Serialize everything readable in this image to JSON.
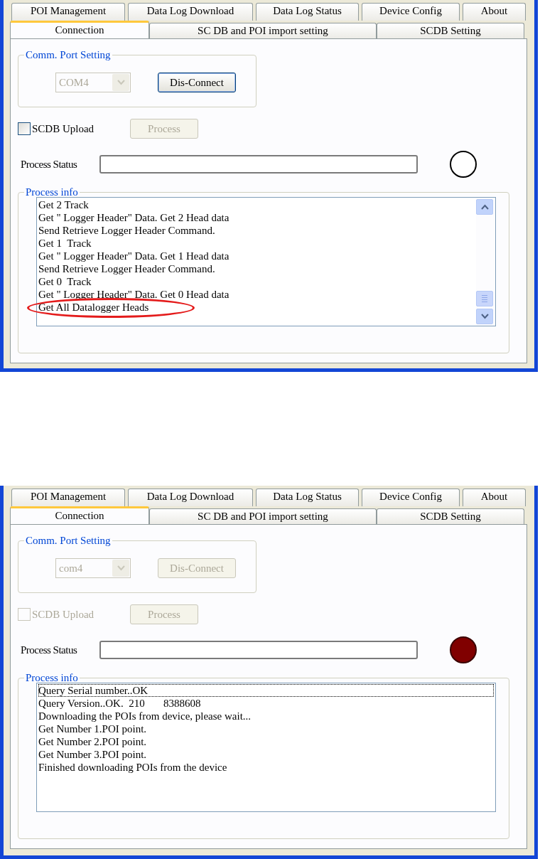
{
  "panels": [
    {
      "tab_rows": [
        [
          {
            "label": "POI Management",
            "selected": false
          },
          {
            "label": "Data Log Download",
            "selected": false
          },
          {
            "label": "Data Log Status",
            "selected": false
          },
          {
            "label": "Device Config",
            "selected": false
          },
          {
            "label": "About",
            "selected": false
          }
        ],
        [
          {
            "label": "Connection",
            "selected": true
          },
          {
            "label": "SC DB and POI import setting",
            "selected": false
          },
          {
            "label": "SCDB  Setting",
            "selected": false
          }
        ]
      ],
      "port_group": {
        "title": "Comm. Port Setting",
        "port": {
          "value": "COM4",
          "disabled": true
        },
        "connect_button": {
          "label": "Dis-Connect",
          "disabled": false
        }
      },
      "upload": {
        "label": "SCDB Upload",
        "checked": false,
        "disabled": false
      },
      "process_button": {
        "label": "Process",
        "disabled": true
      },
      "status": {
        "label": "Process Status",
        "indicator_on": false
      },
      "info_group": {
        "title": "Process info",
        "has_scrollbar": true,
        "lines": [
          {
            "text": "Get 2 Track",
            "selected": false,
            "circled": false
          },
          {
            "text": "Get \" Logger Header\" Data. Get 2 Head data",
            "selected": false,
            "circled": false
          },
          {
            "text": "Send Retrieve Logger Header Command.",
            "selected": false,
            "circled": false
          },
          {
            "text": "Get 1  Track",
            "selected": false,
            "circled": false
          },
          {
            "text": "Get \" Logger Header\" Data. Get 1 Head data",
            "selected": false,
            "circled": false
          },
          {
            "text": "Send Retrieve Logger Header Command.",
            "selected": false,
            "circled": false
          },
          {
            "text": "Get 0  Track",
            "selected": false,
            "circled": false
          },
          {
            "text": "Get \" Logger Header\" Data. Get 0 Head data",
            "selected": false,
            "circled": false
          },
          {
            "text": "Get All Datalogger Heads",
            "selected": false,
            "circled": true
          }
        ]
      }
    },
    {
      "tab_rows": [
        [
          {
            "label": "POI Management",
            "selected": false
          },
          {
            "label": "Data Log Download",
            "selected": false
          },
          {
            "label": "Data Log Status",
            "selected": false
          },
          {
            "label": "Device Config",
            "selected": false
          },
          {
            "label": "About",
            "selected": false
          }
        ],
        [
          {
            "label": "Connection",
            "selected": true
          },
          {
            "label": "SC DB and POI import setting",
            "selected": false
          },
          {
            "label": "SCDB  Setting",
            "selected": false
          }
        ]
      ],
      "port_group": {
        "title": "Comm. Port Setting",
        "port": {
          "value": "com4",
          "disabled": true
        },
        "connect_button": {
          "label": "Dis-Connect",
          "disabled": true
        }
      },
      "upload": {
        "label": "SCDB Upload",
        "checked": false,
        "disabled": true
      },
      "process_button": {
        "label": "Process",
        "disabled": true
      },
      "status": {
        "label": "Process Status",
        "indicator_on": true
      },
      "info_group": {
        "title": "Process info",
        "has_scrollbar": false,
        "lines": [
          {
            "text": "Query Serial number..OK",
            "selected": true,
            "circled": false
          },
          {
            "text": "Query Version..OK.  210       8388608",
            "selected": false,
            "circled": false
          },
          {
            "text": "Downloading the POIs from device, please wait...",
            "selected": false,
            "circled": false
          },
          {
            "text": "Get Number 1.POI point.",
            "selected": false,
            "circled": false
          },
          {
            "text": "Get Number 2.POI point.",
            "selected": false,
            "circled": false
          },
          {
            "text": "Get Number 3.POI point.",
            "selected": false,
            "circled": false
          },
          {
            "text": "Finished downloading POIs from the device",
            "selected": false,
            "circled": false
          }
        ]
      }
    }
  ]
}
